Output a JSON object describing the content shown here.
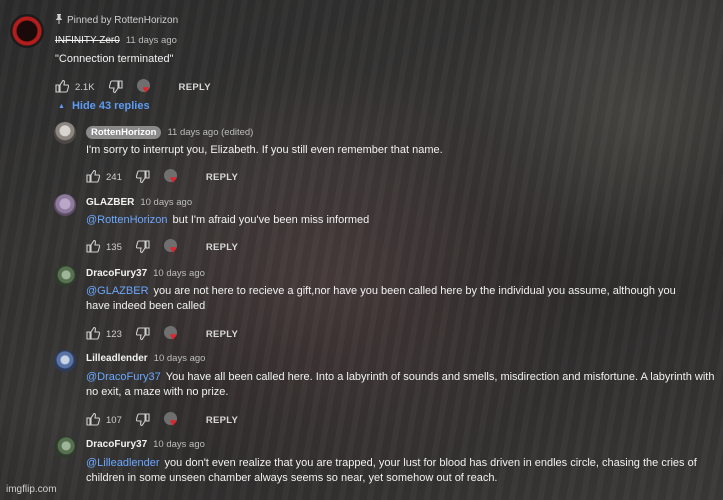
{
  "top_comment": {
    "pinned_label": "Pinned by RottenHorizon",
    "author": "INFINITY Zer0",
    "timestamp": "11 days ago",
    "text": "\"Connection terminated\"",
    "likes": "2.1K",
    "reply_label": "REPLY"
  },
  "hide_replies_label": "Hide 43 replies",
  "replies": [
    {
      "author": "RottenHorizon",
      "timestamp": "11 days ago (edited)",
      "mention": "",
      "text": "I'm sorry to interrupt you, Elizabeth. If you still even remember that name.",
      "likes": "241",
      "reply_label": "REPLY"
    },
    {
      "author": "GLAZBER",
      "timestamp": "10 days ago",
      "mention": "@RottenHorizon",
      "text": "but I'm afraid you've been miss informed",
      "likes": "135",
      "reply_label": "REPLY"
    },
    {
      "author": "DracoFury37",
      "timestamp": "10 days ago",
      "mention": "@GLAZBER",
      "text": "you are not here to recieve a gift,nor have you been called here by the individual you assume, although you have indeed been called",
      "likes": "123",
      "reply_label": "REPLY"
    },
    {
      "author": "Lilleadlender",
      "timestamp": "10 days ago",
      "mention": "@DracoFury37",
      "text": "You have all been called here. Into a labyrinth of sounds and smells, misdirection and misfortune. A labyrinth with no exit, a maze with no prize.",
      "likes": "107",
      "reply_label": "REPLY"
    },
    {
      "author": "DracoFury37",
      "timestamp": "10 days ago",
      "mention": "@Lilleadlender",
      "text": "you don't even realize that you are trapped, your lust for blood has driven in endles circle, chasing the cries of children in some unseen chamber always seems so near, yet somehow out of reach.",
      "likes": "",
      "reply_label": ""
    }
  ],
  "watermark": "imgflip.com",
  "colors": {
    "mention": "#6aa8ff",
    "hide_replies": "#5d9cf5",
    "heart": "#e0242b",
    "author_chip": "#8a8a8a"
  },
  "icons": [
    "pin-icon",
    "thumb-up-icon",
    "thumb-down-icon",
    "creator-heart-icon",
    "caret-up-icon"
  ]
}
